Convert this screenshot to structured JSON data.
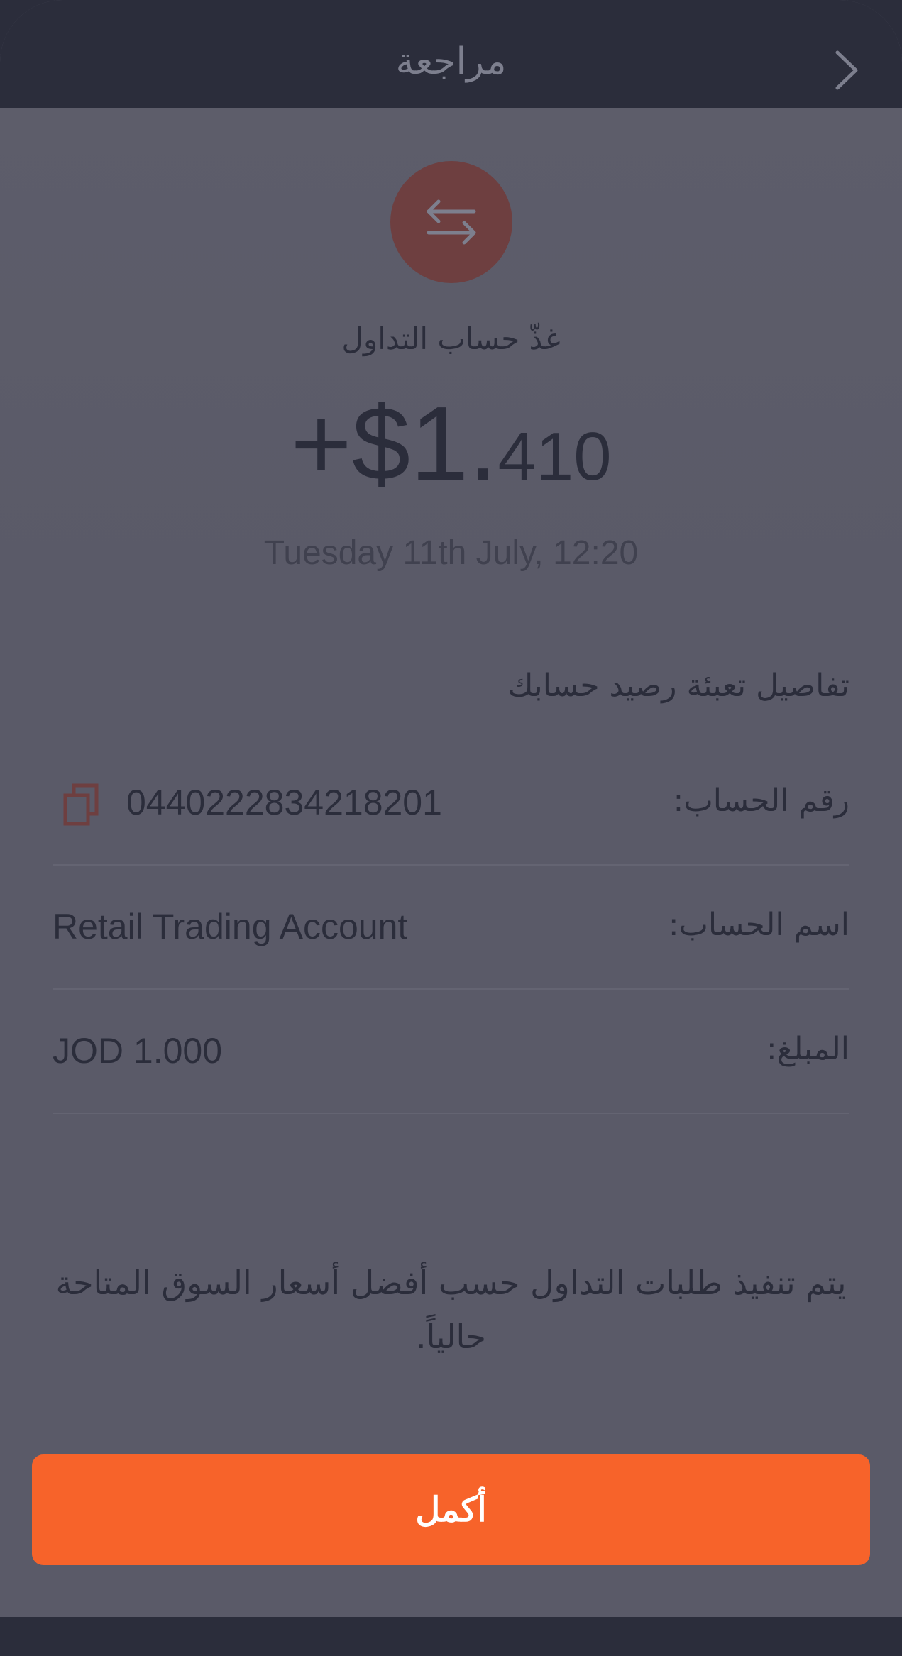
{
  "header": {
    "title": "مراجعة",
    "back_icon": "chevron-right-icon"
  },
  "summary": {
    "icon": "transfer-arrows-icon",
    "icon_color": "#6e3f40",
    "subtitle": "غذّ حساب التداول",
    "amount_main": "+$1.",
    "amount_fraction": "410",
    "date": "Tuesday 11th July, 12:20"
  },
  "details": {
    "section_title": "تفاصيل تعبئة رصيد حسابك",
    "rows": [
      {
        "label": "رقم الحساب:",
        "value": "0440222834218201",
        "copy_icon": "copy-icon"
      },
      {
        "label": "اسم الحساب:",
        "value": "Retail Trading Account"
      },
      {
        "label": "المبلغ:",
        "value": "JOD 1.000"
      }
    ]
  },
  "note": "يتم تنفيذ طلبات التداول حسب أفضل أسعار السوق المتاحة حالياً.",
  "actions": {
    "complete_label": "أكمل",
    "accent_color": "#f7632a"
  }
}
